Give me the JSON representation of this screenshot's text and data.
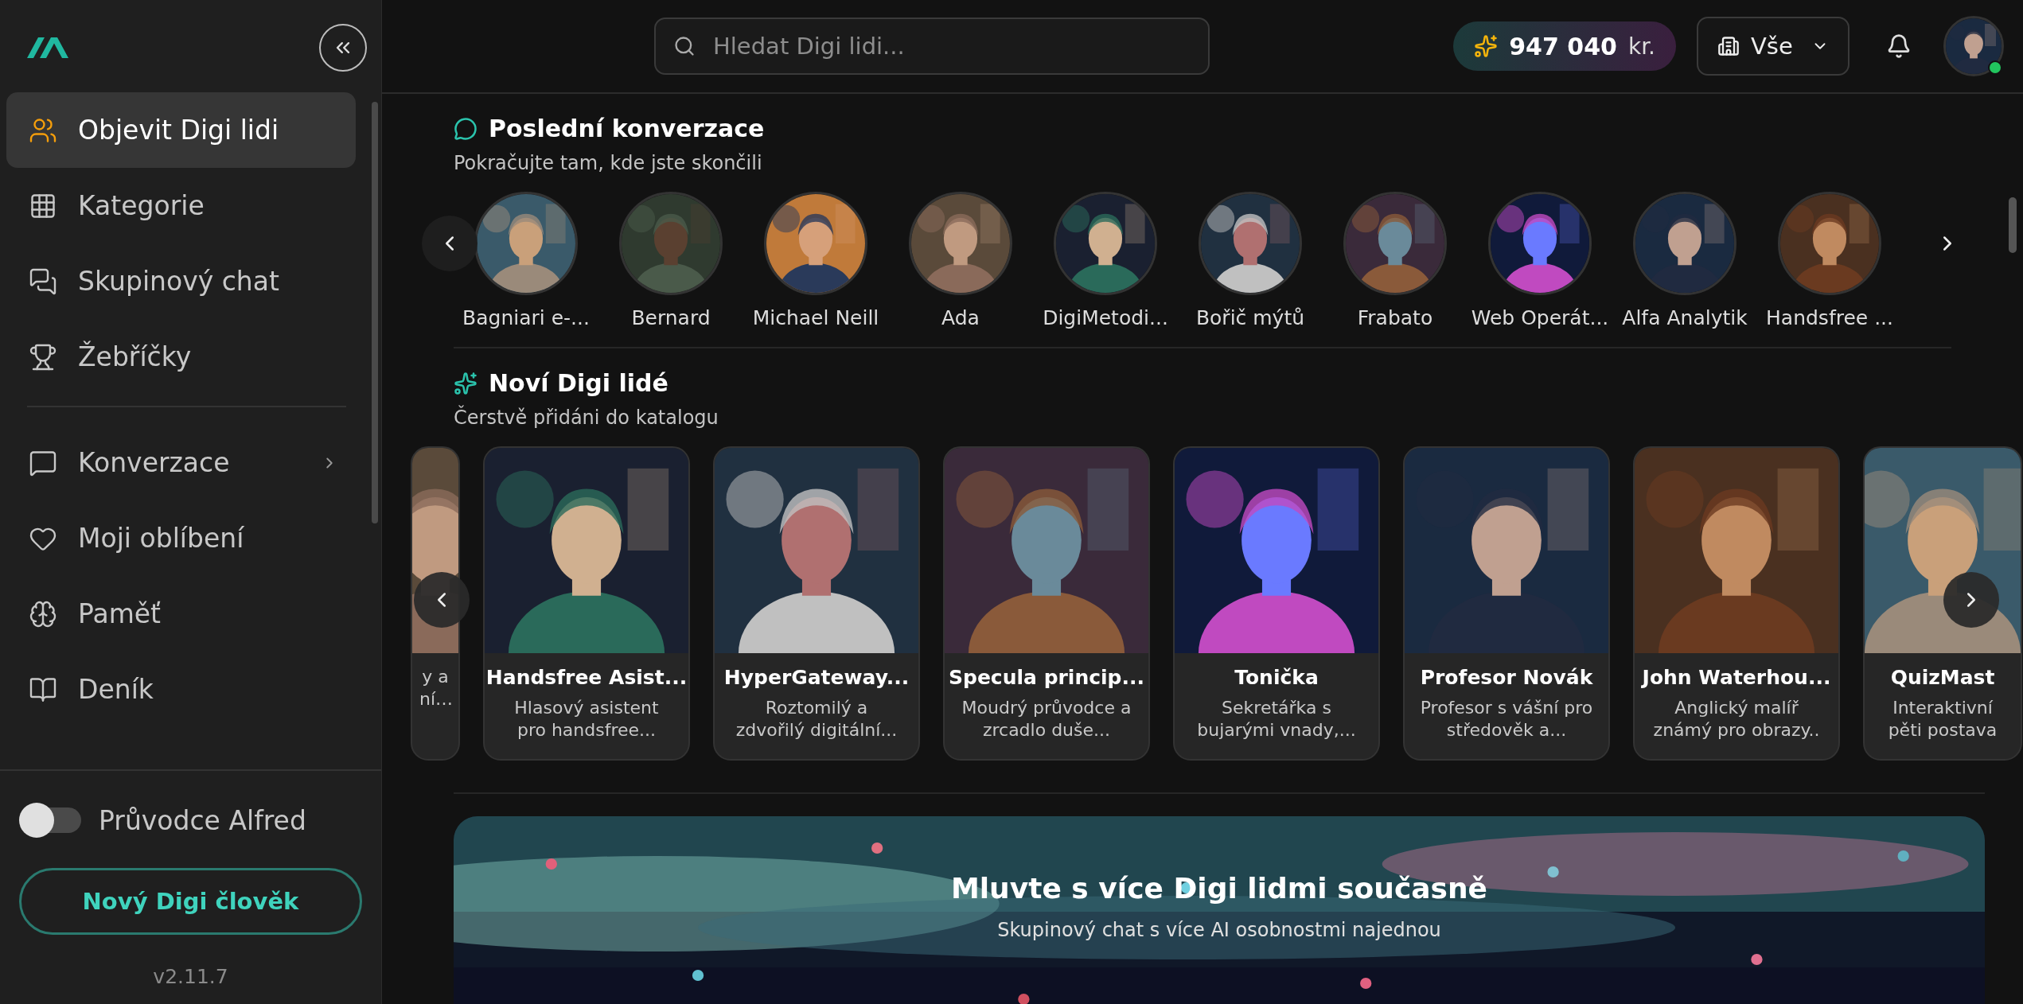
{
  "sidebar": {
    "nav": [
      {
        "label": "Objevit Digi lidi",
        "selected": true,
        "expandable": false
      },
      {
        "label": "Kategorie",
        "selected": false,
        "expandable": false
      },
      {
        "label": "Skupinový chat",
        "selected": false,
        "expandable": false
      },
      {
        "label": "Žebříčky",
        "selected": false,
        "expandable": false
      }
    ],
    "secondary": [
      {
        "label": "Konverzace",
        "selected": false,
        "expandable": true
      },
      {
        "label": "Moji oblíbení",
        "selected": false,
        "expandable": false
      },
      {
        "label": "Paměť",
        "selected": false,
        "expandable": false
      },
      {
        "label": "Deník",
        "selected": false,
        "expandable": false
      }
    ],
    "guide_toggle": {
      "label": "Průvodce Alfred",
      "on": false
    },
    "new_button": "Nový Digi člověk",
    "version": "v2.11.7"
  },
  "topbar": {
    "search": {
      "placeholder": "Hledat Digi lidi..."
    },
    "credits": {
      "amount": "947 040",
      "unit": "kr."
    },
    "filter": {
      "value": "Vše"
    }
  },
  "recent": {
    "title": "Poslední konverzace",
    "subtitle": "Pokračujte tam, kde jste skončili",
    "people": [
      {
        "name": "Bagniari e-..."
      },
      {
        "name": "Bernard"
      },
      {
        "name": "Michael Neill"
      },
      {
        "name": "Ada"
      },
      {
        "name": "DigiMetodi..."
      },
      {
        "name": "Bořič mýtů"
      },
      {
        "name": "Frabato"
      },
      {
        "name": "Web Operát..."
      },
      {
        "name": "Alfa Analytik"
      },
      {
        "name": "Handsfree ..."
      }
    ]
  },
  "new_people": {
    "title": "Noví Digi lidé",
    "subtitle": "Čerstvě přidáni do katalogu",
    "cards": [
      {
        "description": "y a ní…"
      },
      {
        "name": "Handsfree Asist...",
        "description": "Hlasový asistent pro handsfree..."
      },
      {
        "name": "HyperGateway...",
        "description": "Roztomilý a zdvořilý digitální..."
      },
      {
        "name": "Specula princip...",
        "description": "Moudrý průvodce a zrcadlo duše..."
      },
      {
        "name": "Tonička",
        "description": "Sekretářka s bujarými vnady,..."
      },
      {
        "name": "Profesor Novák",
        "description": "Profesor s vášní pro středověk a..."
      },
      {
        "name": "John Waterhou...",
        "description": "Anglický malíř známý pro obrazy.."
      },
      {
        "name": "QuizMast",
        "description": "Interaktivní pěti postava"
      }
    ]
  },
  "banner": {
    "title": "Mluvte s více Digi lidmi současně",
    "subtitle": "Skupinový chat s více AI osobnostmi najednou"
  }
}
